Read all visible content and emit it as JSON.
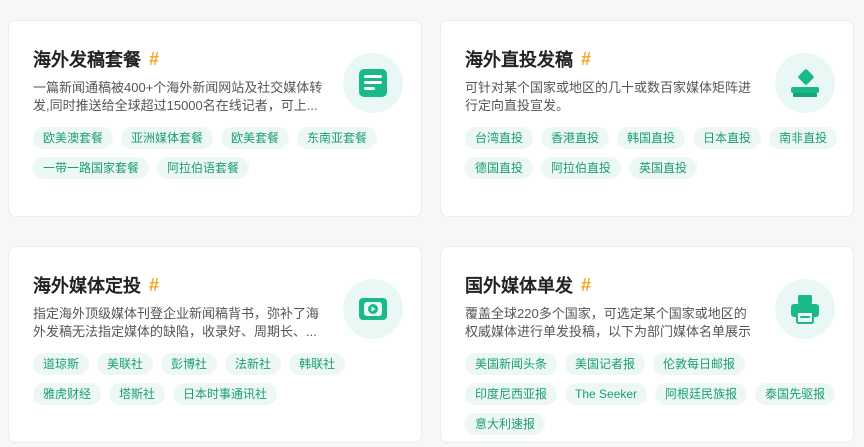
{
  "colors": {
    "accent": "#1ab98a",
    "hash": "#f5a623",
    "tag_bg": "#edf8f4",
    "tag_text": "#1a9d75"
  },
  "cards": [
    {
      "title": "海外发稿套餐",
      "hash": "#",
      "desc": "一篇新闻通稿被400+个海外新闻网站及社交媒体转发,同时推送给全球超过15000名在线记者，可上...",
      "icon": "newspaper-package-icon",
      "tags": [
        "欧美澳套餐",
        "亚洲媒体套餐",
        "欧美套餐",
        "东南亚套餐",
        "一带一路国家套餐",
        "阿拉伯语套餐"
      ]
    },
    {
      "title": "海外直投发稿",
      "hash": "#",
      "desc": "可针对某个国家或地区的几十或数百家媒体矩阵进行定向直投宣发。",
      "icon": "ballot-box-icon",
      "tags": [
        "台湾直投",
        "香港直投",
        "韩国直投",
        "日本直投",
        "南非直投",
        "德国直投",
        "阿拉伯直投",
        "英国直投"
      ]
    },
    {
      "title": "海外媒体定投",
      "hash": "#",
      "desc": "指定海外顶级媒体刊登企业新闻稿背书，弥补了海外发稿无法指定媒体的缺陷，收录好、周期长、...",
      "icon": "video-screen-icon",
      "tags": [
        "道琼斯",
        "美联社",
        "彭博社",
        "法新社",
        "韩联社",
        "雅虎财经",
        "塔斯社",
        "日本时事通讯社"
      ]
    },
    {
      "title": "国外媒体单发",
      "hash": "#",
      "desc": "覆盖全球220多个国家，可选定某个国家或地区的权威媒体进行单发投稿，以下为部门媒体名单展示",
      "icon": "printer-icon",
      "tags": [
        "美国新闻头条",
        "美国记者报",
        "伦敦每日邮报",
        "印度尼西亚报",
        "The Seeker",
        "阿根廷民族报",
        "泰国先驱报",
        "意大利速报"
      ]
    }
  ]
}
